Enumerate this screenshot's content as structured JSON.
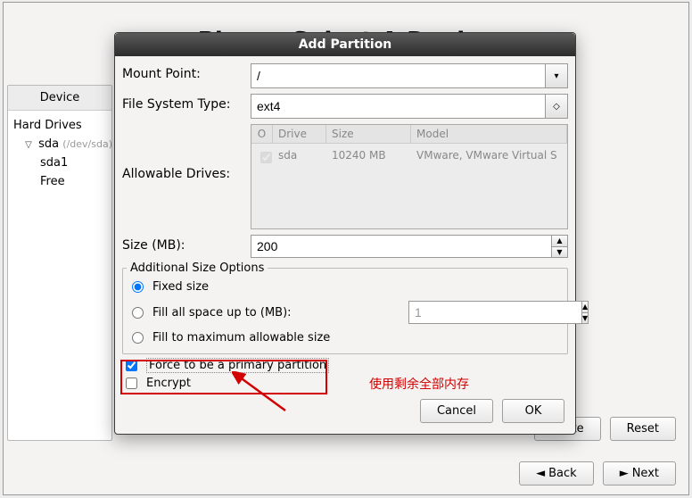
{
  "bg": {
    "title": "Please Select A Device",
    "left_panel": {
      "header": "Device",
      "section": "Hard Drives",
      "disk_name": "sda",
      "disk_path": "(/dev/sda)",
      "children": [
        "sda1",
        "Free"
      ]
    },
    "buttons": {
      "delete": "...lete",
      "reset": "Reset"
    },
    "nav": {
      "back": "Back",
      "next": "Next"
    }
  },
  "dialog": {
    "title": "Add Partition",
    "labels": {
      "mount_point": "Mount Point:",
      "fs_type": "File System Type:",
      "drives": "Allowable Drives:",
      "size": "Size (MB):",
      "additional": "Additional Size Options",
      "fixed": "Fixed size",
      "fill_up": "Fill all space up to (MB):",
      "fill_max": "Fill to maximum allowable size",
      "primary": "Force to be a primary partition",
      "encrypt": "Encrypt"
    },
    "values": {
      "mount_point": "/",
      "fs_type": "ext4",
      "size": "200",
      "fill_up_spin": "1"
    },
    "drives_table": {
      "headers": {
        "check": "O",
        "drive": "Drive",
        "size": "Size",
        "model": "Model"
      },
      "row": {
        "drive": "sda",
        "size": "10240 MB",
        "model": "VMware, VMware Virtual S"
      }
    },
    "buttons": {
      "cancel": "Cancel",
      "ok": "OK"
    },
    "state": {
      "primary_checked": true,
      "encrypt_checked": false,
      "size_option": "fixed"
    }
  },
  "annotation": {
    "text": "使用剩余全部内存"
  }
}
